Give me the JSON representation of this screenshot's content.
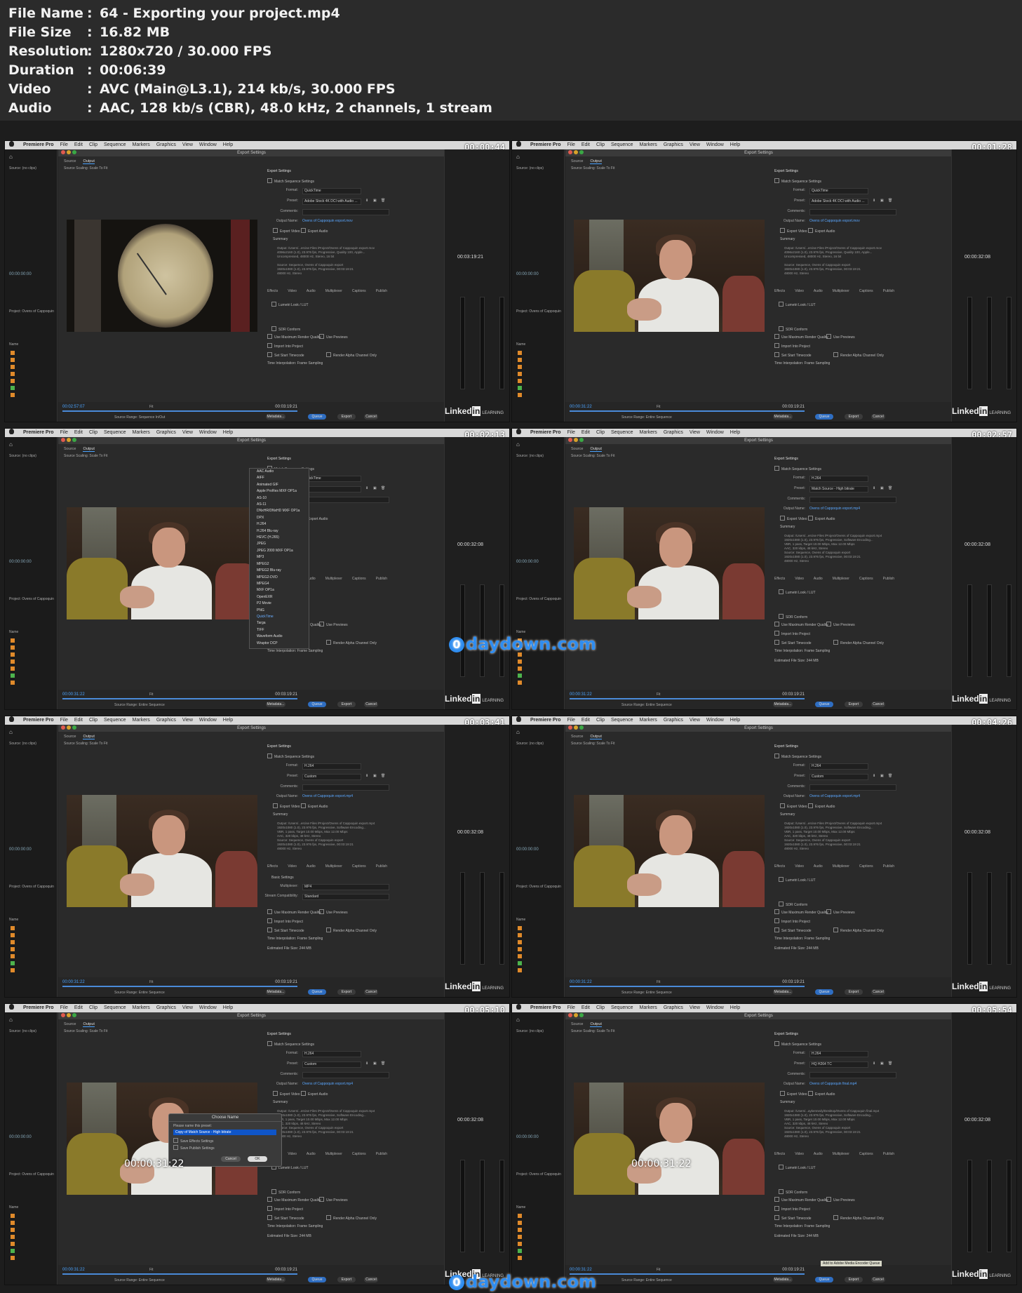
{
  "info": [
    {
      "key": "File Name",
      "value": "64 - Exporting your project.mp4"
    },
    {
      "key": "File Size",
      "value": "16.82 MB"
    },
    {
      "key": "Resolution",
      "value": "1280x720 / 30.000 FPS"
    },
    {
      "key": "Duration",
      "value": "00:06:39"
    },
    {
      "key": "Video",
      "value": "AVC (Main@L3.1), 214 kb/s, 30.000 FPS"
    },
    {
      "key": "Audio",
      "value": "AAC, 128 kb/s (CBR), 48.0 kHz, 2 channels, 1 stream"
    }
  ],
  "info_separator": ":",
  "ui": {
    "app": "Premiere Pro",
    "menu": [
      "File",
      "Edit",
      "Clip",
      "Sequence",
      "Markers",
      "Graphics",
      "View",
      "Window",
      "Help"
    ],
    "dialog_title": "Export Settings",
    "tab_source": "Source",
    "tab_output": "Output",
    "source_scaling_label": "Source Scaling:",
    "source_scaling": "Scale To Fit",
    "source_label": "Source: (no clips)",
    "project_label": "Project: Ovens of Cappoquin",
    "name_col": "Name",
    "left_timecode": "00:00:00:00",
    "export_settings": "Export Settings",
    "match_sequence": "Match Sequence Settings",
    "format_label": "Format:",
    "preset_label": "Preset:",
    "comments_label": "Comments:",
    "output_name_label": "Output Name:",
    "export_video": "Export Video",
    "export_audio": "Export Audio",
    "summary_label": "Summary",
    "effects_tabs": [
      "Effects",
      "Video",
      "Audio",
      "Multiplexer",
      "Captions",
      "Publish"
    ],
    "lumetri": "Lumetri Look / LUT",
    "sdr": "SDR Conform",
    "max_render": "Use Maximum Render Quality",
    "use_previews": "Use Previews",
    "import_project": "Import Into Project",
    "set_start_tc": "Set Start Timecode",
    "render_alpha": "Render Alpha Channel Only",
    "time_interp_label": "Time Interpolation:",
    "time_interp": "Frame Sampling",
    "est_size": "Estimated File Size: 244 MB",
    "source_range_label": "Source Range:",
    "fit": "Fit",
    "metadata_btn": "Metadata...",
    "queue_btn": "Queue",
    "export_btn": "Export",
    "cancel_btn": "Cancel",
    "total_time": "00:03:19:21",
    "right_time": "00:00:32:08",
    "linkedin": "Linked",
    "linkedin_in": "in",
    "learning": "LEARNING"
  },
  "frames": [
    {
      "ts": "00:00:44",
      "format": "QuickTime",
      "preset": "Adobe Stock 4K DCI with Audio ...",
      "output": "Ovens of Cappoquin export.mov",
      "summary": "Output: /Users/...ercise Files /Project/Ovens of Cappoquin export.mov\n4096x2160 (1.0), 23.976 fps, Progressive, Quality 100, Apple...\nUncompressed, 48000 Hz, Stereo, 16 bit\n\nSource: Sequence, Ovens of Cappoquin export\n1920x1080 (1.0), 23.976 fps, Progressive, 00:03:19:21\n48000 Hz, Stereo",
      "cur": "00:02:57:07",
      "range": "Sequence In/Out",
      "right_time": "00:03:19:21"
    },
    {
      "ts": "00:01:28",
      "format": "QuickTime",
      "preset": "Adobe Stock 4K DCI with Audio ...",
      "output": "Ovens of Cappoquin export.mov",
      "summary": "Output: /Users/...ercise Files /Project/Ovens of Cappoquin export.mov\n4096x2160 (1.0), 23.976 fps, Progressive, Quality 100, Apple...\nUncompressed, 48000 Hz, Stereo, 16 bit\n\nSource: Sequence, Ovens of Cappoquin export\n1920x1080 (1.0), 23.976 fps, Progressive, 00:03:19:21\n48000 Hz, Stereo",
      "cur": "00:00:31:22",
      "range": "Entire Sequence",
      "right_time": "00:00:32:08"
    },
    {
      "ts": "00:02:13",
      "format": "QuickTime",
      "preset": "",
      "output": "",
      "summary": "",
      "cur": "00:00:31:22",
      "range": "Entire Sequence",
      "right_time": "00:00:32:08"
    },
    {
      "ts": "00:02:57",
      "format": "H.264",
      "preset": "Match Source - High bitrate",
      "output": "Ovens of Cappoquin export.mp4",
      "summary": "Output: /Users/...ercise Files /Project/Ovens of Cappoquin export.mp4\n1920x1080 (1.0), 23.976 fps, Progressive, Software Encoding...\nVBR, 1 pass, Target 10.00 Mbps, Max 12.00 Mbps\nAAC, 320 kbps, 48 kHz, Stereo\nSource: Sequence, Ovens of Cappoquin export\n1920x1080 (1.0), 23.976 fps, Progressive, 00:03:19:21\n48000 Hz, Stereo",
      "cur": "00:00:31:22",
      "range": "Entire Sequence",
      "right_time": "00:00:32:08"
    },
    {
      "ts": "00:03:41",
      "format": "H.264",
      "preset": "Custom",
      "output": "Ovens of Cappoquin export.mp4",
      "summary": "Output: /Users/...ercise Files /Project/Ovens of Cappoquin export.mp4\n1920x1080 (1.0), 23.976 fps, Progressive, Software Encoding...\nVBR, 1 pass, Target 10.00 Mbps, Max 12.00 Mbps\nAAC, 320 kbps, 48 kHz, Stereo\nSource: Sequence, Ovens of Cappoquin export\n1920x1080 (1.0), 23.976 fps, Progressive, 00:03:19:21\n48000 Hz, Stereo",
      "cur": "00:00:31:22",
      "range": "Entire Sequence",
      "right_time": "00:00:32:08"
    },
    {
      "ts": "00:04:26",
      "format": "H.264",
      "preset": "Custom",
      "output": "Ovens of Cappoquin export.mp4",
      "summary": "Output: /Users/...ercise Files /Project/Ovens of Cappoquin export.mp4\n1920x1080 (1.0), 23.976 fps, Progressive, Software Encoding...\nVBR, 1 pass, Target 10.00 Mbps, Max 12.00 Mbps\nAAC, 320 kbps, 48 kHz, Stereo\nSource: Sequence, Ovens of Cappoquin export\n1920x1080 (1.0), 23.976 fps, Progressive, 00:03:19:21\n48000 Hz, Stereo",
      "cur": "00:00:31:22",
      "range": "Entire Sequence",
      "right_time": "00:00:32:08"
    },
    {
      "ts": "00:05:10",
      "format": "H.264",
      "preset": "Custom",
      "output": "Ovens of Cappoquin export.mp4",
      "summary": "Output: /Users/...ercise Files /Project/Ovens of Cappoquin export.mp4\n1920x1080 (1.0), 23.976 fps, Progressive, Software Encoding...\nVBR, 1 pass, Target 10.00 Mbps, Max 12.00 Mbps\nAAC, 320 kbps, 48 kHz, Stereo\nSource: Sequence, Ovens of Cappoquin export\n1920x1080 (1.0), 23.976 fps, Progressive, 00:03:19:21\n48000 Hz, Stereo",
      "cur": "00:00:31:22",
      "range": "Entire Sequence",
      "right_time": "00:00:32:08"
    },
    {
      "ts": "00:05:54",
      "format": "H.264",
      "preset": "HQ H264 TC",
      "output": "Ovens of Cappoquin final.mp4",
      "summary": "Output: /Users/...aykennedy/Desktop/Ovens of Cappoquin final.mp4\n1920x1080 (1.0), 23.976 fps, Progressive, Software Encoding...\nVBR, 1 pass, Target 10.00 Mbps, Max 12.00 Mbps\nAAC, 320 kbps, 48 kHz, Stereo\nSource: Sequence, Ovens of Cappoquin export\n1920x1080 (1.0), 23.976 fps, Progressive, 00:03:19:21\n48000 Hz, Stereo",
      "cur": "00:00:31:22",
      "range": "Entire Sequence",
      "right_time": "00:00:32:08"
    }
  ],
  "format_list": [
    "AAC Audio",
    "AIFF",
    "Animated GIF",
    "Apple ProRes MXF OP1a",
    "AS-10",
    "AS-11",
    "DNxHR/DNxHD MXF OP1a",
    "DPX",
    "H.264",
    "H.264 Blu-ray",
    "HEVC (H.265)",
    "JPEG",
    "JPEG 2000 MXF OP1a",
    "MP3",
    "MPEG2",
    "MPEG2 Blu-ray",
    "MPEG2-DVD",
    "MPEG4",
    "MXF OP1a",
    "OpenEXR",
    "P2 Movie",
    "PNG",
    "QuickTime",
    "Targa",
    "TIFF",
    "Waveform Audio",
    "Wraptor DCP"
  ],
  "format_selected": "QuickTime",
  "modal": {
    "title": "Choose Name",
    "prompt": "Please name this preset:",
    "value": "Copy of Match Source - High bitrate",
    "save_effects": "Save Effects Settings",
    "save_publish": "Save Publish Settings",
    "cancel": "Cancel",
    "ok": "OK"
  },
  "overlay_time": "00:00:31:22",
  "multiplexer": {
    "basic_settings": "Basic Settings",
    "mux_label": "Multiplexer:",
    "mux": "MP4",
    "stream_label": "Stream Compatibility:",
    "stream": "Standard"
  },
  "tooltip": "Add to Adobe Media Encoder Queue",
  "watermark": {
    "badge": "0",
    "text": "daydown.com"
  },
  "colors": {
    "accent": "#2f6ec2",
    "timecode_blue": "#4aa3ff",
    "watermark": "#2f8df0"
  }
}
